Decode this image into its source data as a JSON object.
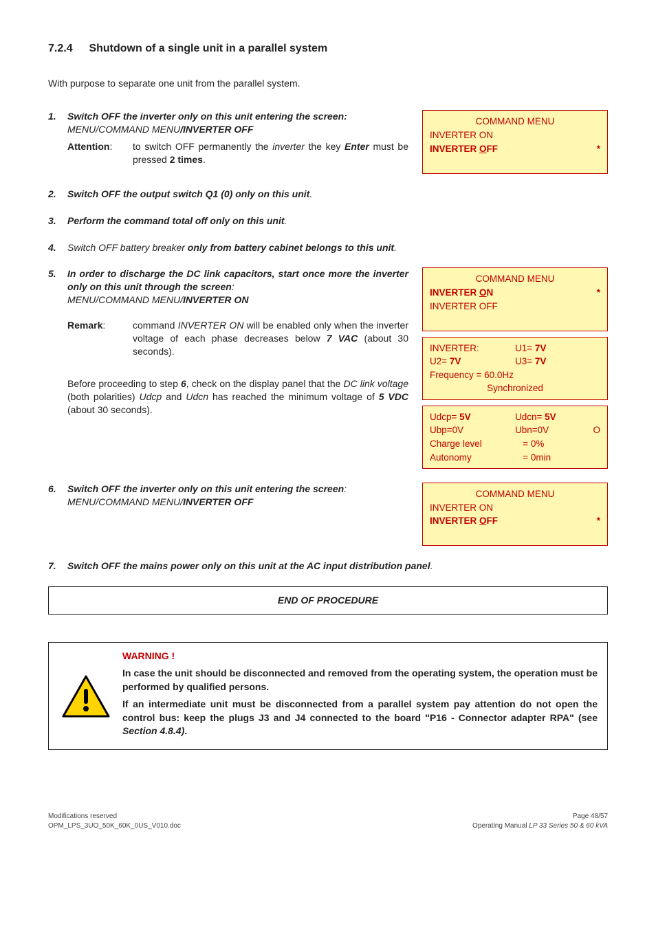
{
  "heading": {
    "num": "7.2.4",
    "title": "Shutdown of a single unit in a parallel system"
  },
  "intro": "With purpose to separate one unit from the parallel system.",
  "step1": {
    "num": "1.",
    "lead": "Switch OFF the inverter only on this unit entering the screen:",
    "path": "MENU/COMMAND MENU/INVERTER OFF",
    "attLabel": "Attention",
    "attColon": ":",
    "attText1": "to switch OFF permanently the ",
    "attItalic": "inverter",
    "attText2": " the key ",
    "attBold1": "Enter",
    "attText3": " must be pressed ",
    "attBold2": "2 times",
    "attText4": "."
  },
  "lcd1": {
    "title": "COMMAND MENU",
    "l1": "INVERTER ON",
    "l2a": "INVERTER ",
    "l2b": "O",
    "l2c": "FF",
    "star": "*"
  },
  "step2": {
    "num": "2.",
    "lead": "Switch OFF the output switch Q1 (0) only on this unit",
    "tail": "."
  },
  "step3": {
    "num": "3.",
    "lead": "Perform the command total off only on this unit",
    "tail": "."
  },
  "step4": {
    "num": "4.",
    "p1": "Switch OFF battery breaker",
    "p2": " only from battery cabinet belongs to  this unit",
    "tail": "."
  },
  "step5": {
    "num": "5.",
    "lead": "In order to discharge the DC link capacitors, start once more the inverter only on this unit through the screen",
    "leadTail": ":",
    "path1": "MENU/COMMAND MENU/",
    "path2": "INVERTER ON",
    "rLabel": "Remark",
    "rColon": ":",
    "r1": "command ",
    "rItal": "INVERTER ON",
    "r2": " will be enabled only when the inverter voltage of each phase decreases below ",
    "rBold": "7 VAC",
    "r3": " (about 30 seconds).",
    "before1": "Before proceeding to step ",
    "beforeStep": "6",
    "before2": ", check on the display panel that the ",
    "beforeItal1": "DC link voltage",
    "before3": " (both polarities) ",
    "beforeItal2": "Udcp",
    "before4": " and ",
    "beforeItal3": "Udcn",
    "before5": " has reached the minimum voltage of ",
    "beforeBold": "5 VDC",
    "before6": " (about 30 seconds)."
  },
  "lcd5a": {
    "title": "COMMAND MENU",
    "l1a": "INVERTER ",
    "l1b": "O",
    "l1c": "N",
    "star": "*",
    "l2": "INVERTER OFF"
  },
  "lcd5b": {
    "r1a": "INVERTER:",
    "r1b": "U1=  ",
    "r1bv": "7V",
    "r2a": "U2=  ",
    "r2av": "7V",
    "r2b": "U3=  ",
    "r2bv": "7V",
    "r3": "Frequency   =   60.0Hz",
    "r4": "Synchronized"
  },
  "lcd5c": {
    "r1a": "Udcp=   ",
    "r1av": "5V",
    "r1b": "Udcn=   ",
    "r1bv": "5V",
    "r2a": "Ubp=0V",
    "r2b": "Ubn=0V",
    "r2c": "O",
    "r3a": "Charge level",
    "r3b": "=   0%",
    "r4a": "Autonomy",
    "r4b": "=   0min"
  },
  "step6": {
    "num": "6.",
    "lead": "Switch OFF the inverter only on this unit entering the screen",
    "leadTail": ":",
    "path1": "MENU/COMMAND MENU/",
    "path2": "INVERTER OFF"
  },
  "lcd6": {
    "title": "COMMAND MENU",
    "l1": "INVERTER ON",
    "l2a": "INVERTER ",
    "l2b": "O",
    "l2c": "FF",
    "star": "*"
  },
  "step7": {
    "num": "7.",
    "lead": "Switch OFF the mains power only on this unit at the AC input distribution panel",
    "tail": "."
  },
  "end": "END OF PROCEDURE",
  "warning": {
    "title": "WARNING !",
    "p1": "In case the unit should be disconnected and removed from the operating system, the operation must be performed by qualified persons.",
    "p2a": "If an intermediate unit must be disconnected from a parallel system pay attention do not open the control bus: keep the plugs J3 and J4 connected to the board \"P16 - Connector adapter RPA\" (see ",
    "p2b": "Section 4.8.4)",
    "p2c": "."
  },
  "footer": {
    "l1": "Modifications reserved",
    "l2": "OPM_LPS_3UO_50K_60K_0US_V010.doc",
    "r1": "Page 48/57",
    "r2a": "Operating Manual ",
    "r2b": "LP 33 Series 50 & 60 kVA"
  }
}
